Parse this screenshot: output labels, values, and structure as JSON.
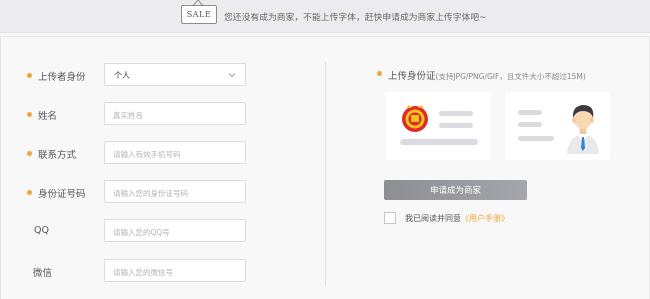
{
  "banner": {
    "tag": "SALE",
    "text": "您还没有成为商家，不能上传字体，赶快申请成为商家上传字体吧~"
  },
  "form": {
    "uploader": {
      "label": "上传者身份",
      "value": "个人",
      "required": true
    },
    "name": {
      "label": "姓名",
      "placeholder": "真实姓名",
      "required": true
    },
    "contact": {
      "label": "联系方式",
      "placeholder": "请输入有效手机号码",
      "required": true
    },
    "id_number": {
      "label": "身份证号码",
      "placeholder": "请输入您的身份证号码",
      "required": true
    },
    "qq": {
      "label": "QQ",
      "placeholder": "请输入您的QQ号",
      "required": false
    },
    "wechat": {
      "label": "微信",
      "placeholder": "请输入您的微信号",
      "required": false
    }
  },
  "id_upload": {
    "label": "上传身份证",
    "hint": "(支持JPG/PNG/GIF，且文件大小不超过15M)",
    "front_icon": "national-emblem-icon",
    "back_icon": "person-portrait-icon"
  },
  "apply_button": "申请成为商家",
  "agreement": {
    "prefix": "我已阅读并同意",
    "link": "《用户手册》",
    "checked": false
  },
  "colors": {
    "accent": "#f0a63a",
    "button": "#9a9ba0",
    "banner_bg": "#ececee"
  }
}
